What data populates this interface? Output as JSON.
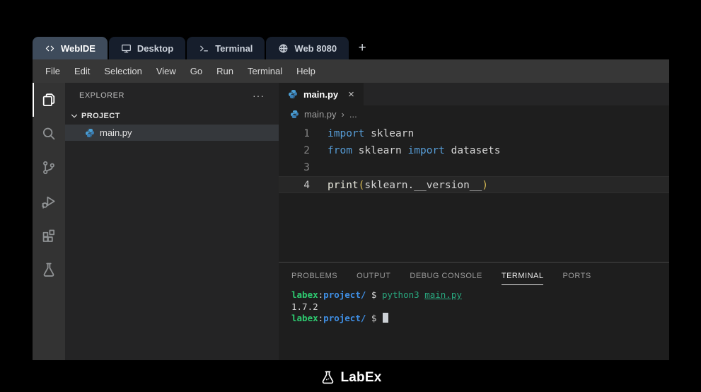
{
  "browser_tabs": {
    "items": [
      {
        "label": "WebIDE",
        "active": true
      },
      {
        "label": "Desktop",
        "active": false
      },
      {
        "label": "Terminal",
        "active": false
      },
      {
        "label": "Web 8080",
        "active": false
      }
    ],
    "new_tab": "+"
  },
  "menu": {
    "items": [
      "File",
      "Edit",
      "Selection",
      "View",
      "Go",
      "Run",
      "Terminal",
      "Help"
    ]
  },
  "explorer": {
    "title": "EXPLORER",
    "more": "···",
    "section": "PROJECT",
    "file": "main.py"
  },
  "editor": {
    "tab_label": "main.py",
    "close": "×",
    "breadcrumb": {
      "file": "main.py",
      "sep": "›",
      "rest": "..."
    },
    "line_numbers": [
      "1",
      "2",
      "3",
      "4"
    ],
    "code": {
      "l1_kw": "import",
      "l1_text": " sklearn",
      "l2_kw1": "from",
      "l2_text1": " sklearn ",
      "l2_kw2": "import",
      "l2_text2": " datasets",
      "l4_fn": "print",
      "l4_open": "(",
      "l4_arg": "sklearn.__version__",
      "l4_close": ")"
    }
  },
  "panel": {
    "tabs": [
      "PROBLEMS",
      "OUTPUT",
      "DEBUG CONSOLE",
      "TERMINAL",
      "PORTS"
    ],
    "active_tab": "TERMINAL"
  },
  "terminal": {
    "user": "labex",
    "colon": ":",
    "dir": "project/",
    "dollar": " $ ",
    "command": "python3 ",
    "command_arg": "main.py",
    "output": "1.7.2"
  },
  "footer": {
    "brand": "LabEx"
  },
  "colors": {
    "keyword": "#569cd6",
    "paren_gold": "#d7ba52",
    "prompt_user_green": "#2ecc71",
    "prompt_dir_blue": "#3f8fe5",
    "command_teal": "#29a87f",
    "active_tab_bg": "#3e4b5b",
    "editor_bg": "#1e1e1e"
  }
}
